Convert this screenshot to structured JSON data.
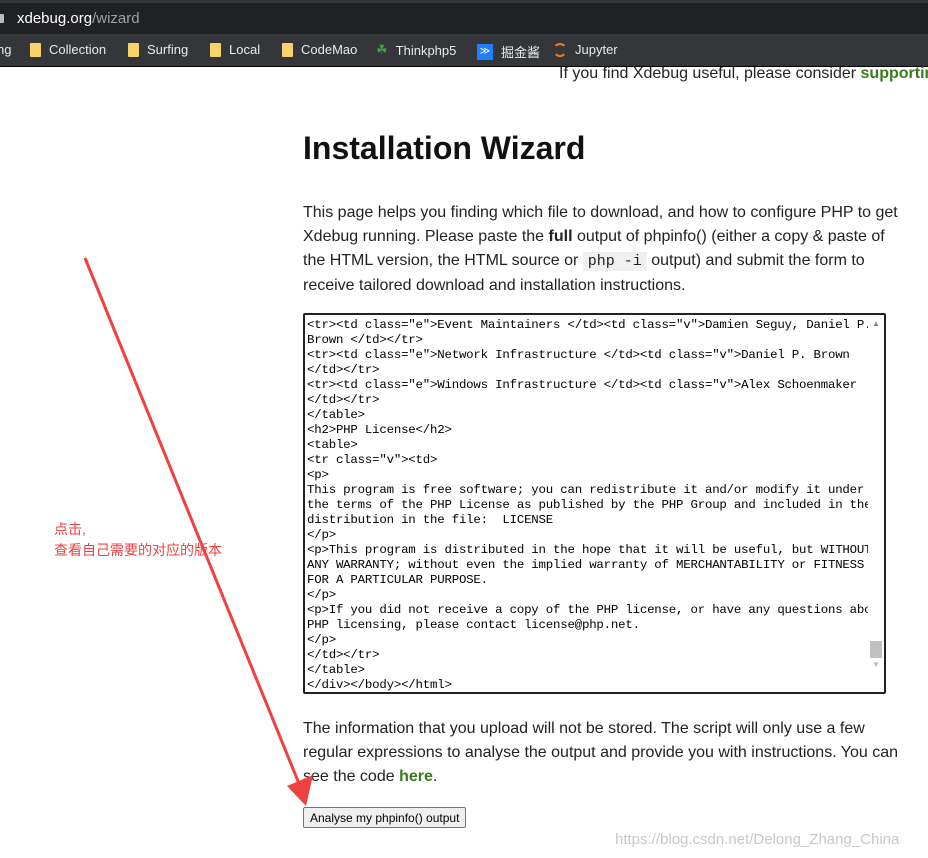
{
  "browser": {
    "url_host": "xdebug.org",
    "url_path": "/wizard",
    "bookmarks": [
      {
        "label": "ng",
        "icon": "folder-icon"
      },
      {
        "label": "Collection",
        "icon": "folder-icon"
      },
      {
        "label": "Surfing",
        "icon": "folder-icon"
      },
      {
        "label": "Local",
        "icon": "folder-icon"
      },
      {
        "label": "CodeMao",
        "icon": "folder-icon"
      },
      {
        "label": "Thinkphp5",
        "icon": "thinkphp-icon"
      },
      {
        "label": "掘金酱",
        "icon": "juejin-icon"
      },
      {
        "label": "Jupyter",
        "icon": "jupyter-icon"
      }
    ]
  },
  "page": {
    "support_text": "If you find Xdebug useful, please consider ",
    "support_link": "supporting",
    "title": "Installation Wizard",
    "intro_1": "This page helps you finding which file to download, and how to configure PHP to get Xdebug running. Please paste the ",
    "intro_bold": "full",
    "intro_2": " output of phpinfo() (either a copy & paste of the HTML version, the HTML source or ",
    "intro_code": "php -i",
    "intro_3": " output) and submit the form to receive tailored download and installation instructions.",
    "textarea_value": "<tr><td class=\"e\">Event Maintainers </td><td class=\"v\">Damien Seguy, Daniel P.\nBrown </td></tr>\n<tr><td class=\"e\">Network Infrastructure </td><td class=\"v\">Daniel P. Brown\n</td></tr>\n<tr><td class=\"e\">Windows Infrastructure </td><td class=\"v\">Alex Schoenmaker\n</td></tr>\n</table>\n<h2>PHP License</h2>\n<table>\n<tr class=\"v\"><td>\n<p>\nThis program is free software; you can redistribute it and/or modify it under\nthe terms of the PHP License as published by the PHP Group and included in the\ndistribution in the file:  LICENSE\n</p>\n<p>This program is distributed in the hope that it will be useful, but WITHOUT\nANY WARRANTY; without even the implied warranty of MERCHANTABILITY or FITNESS\nFOR A PARTICULAR PURPOSE.\n</p>\n<p>If you did not receive a copy of the PHP license, or have any questions about\nPHP licensing, please contact license@php.net.\n</p>\n</td></tr>\n</table>\n</div></body></html>",
    "note_text": "The information that you upload will not be stored. The script will only use a few regular expressions to analyse the output and provide you with instructions. You can see the code ",
    "note_link": "here",
    "note_end": ".",
    "submit_label": "Analyse my phpinfo() output"
  },
  "annotation": {
    "line1": "点击,",
    "line2": "查看自己需要的对应的版本",
    "color": "#f04040"
  },
  "watermark": "https://blog.csdn.net/Delong_Zhang_China",
  "colors": {
    "link": "#3a7a1c",
    "annotation": "#f04040"
  }
}
